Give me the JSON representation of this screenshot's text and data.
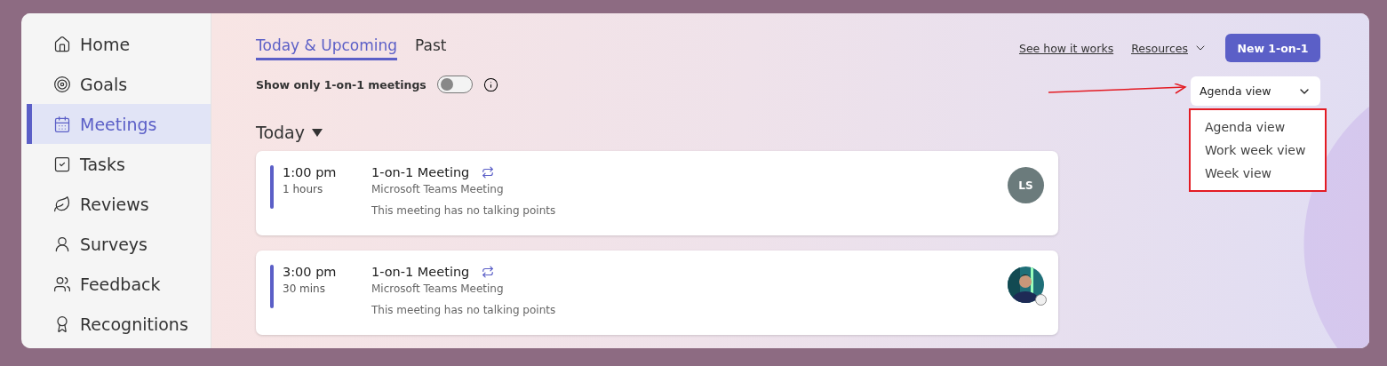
{
  "sidebar": {
    "items": [
      {
        "label": "Home",
        "selected": false
      },
      {
        "label": "Goals",
        "selected": false
      },
      {
        "label": "Meetings",
        "selected": true
      },
      {
        "label": "Tasks",
        "selected": false
      },
      {
        "label": "Reviews",
        "selected": false
      },
      {
        "label": "Surveys",
        "selected": false
      },
      {
        "label": "Feedback",
        "selected": false
      },
      {
        "label": "Recognitions",
        "selected": false
      }
    ]
  },
  "tabs": [
    {
      "label": "Today & Upcoming",
      "selected": true
    },
    {
      "label": "Past",
      "selected": false
    }
  ],
  "filter": {
    "label": "Show only 1-on-1 meetings",
    "on": false
  },
  "header_links": [
    {
      "label": "See how it works",
      "kind": "link"
    },
    {
      "label": "Resources",
      "kind": "menu"
    }
  ],
  "primary_button": "New 1-on-1",
  "view_dropdown": {
    "value": "Agenda view",
    "expanded": true,
    "options": [
      "Agenda view",
      "Work week view",
      "Week view"
    ]
  },
  "section": {
    "title": "Today",
    "expanded": true
  },
  "meetings": [
    {
      "time": "1:00 pm",
      "duration": "1 hours",
      "title": "1-on-1 Meeting",
      "recurring": true,
      "location": "Microsoft Teams Meeting",
      "note": "This meeting has no talking points",
      "avatar": {
        "kind": "initials",
        "text": "LS"
      }
    },
    {
      "time": "3:00 pm",
      "duration": "30 mins",
      "title": "1-on-1 Meeting",
      "recurring": true,
      "location": "Microsoft Teams Meeting",
      "note": "This meeting has no talking points"
    }
  ]
}
